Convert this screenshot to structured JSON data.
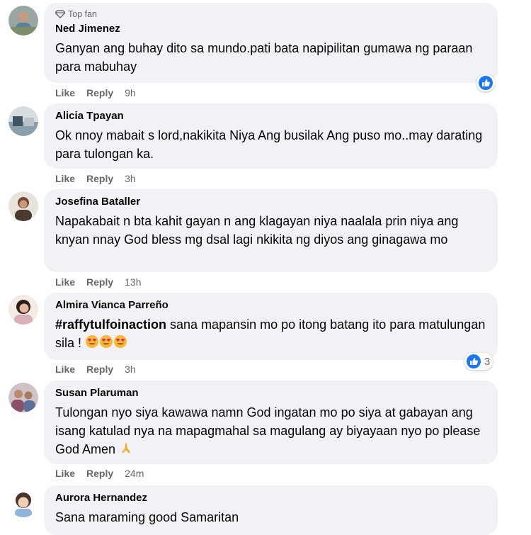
{
  "comments": [
    {
      "badge": "Top fan",
      "name": "Ned Jimenez",
      "text": "Ganyan ang buhay dito sa mundo.pati bata napipilitan gumawa ng paraan para mabuhay",
      "like": "Like",
      "reply": "Reply",
      "time": "9h",
      "reaction_icon": "like-icon"
    },
    {
      "name": "Alicia Tpayan",
      "text": "Ok nnoy mabait s lord,nakikita Niya Ang busilak Ang puso mo..may darating para tulongan ka.",
      "like": "Like",
      "reply": "Reply",
      "time": "3h"
    },
    {
      "name": "Josefina Bataller",
      "text": "Napakabait n bta kahit gayan n ang klagayan niya naalala prin niya ang knyan nnay God bless mg dsal lagi nkikita ng diyos ang ginagawa mo",
      "like": "Like",
      "reply": "Reply",
      "time": "13h"
    },
    {
      "name": "Almira Vianca Parreño",
      "hashtag": "#raffytulfoinaction",
      "text": "sana mapansin mo po itong batang ito para matulungan sila !",
      "emojis": [
        "heart-eyes-emoji",
        "heart-eyes-emoji",
        "heart-eyes-emoji"
      ],
      "like": "Like",
      "reply": "Reply",
      "time": "3h",
      "reaction_icon": "like-icon",
      "reaction_count": "3"
    },
    {
      "name": "Susan Plaruman",
      "text": "Tulongan nyo siya kawawa namn God ingatan mo po siya at gabayan ang isang katulad nya na mapagmahal sa magulang ay biyayaan nyo po please God Amen",
      "emojis": [
        "folded-hands-emoji"
      ],
      "like": "Like",
      "reply": "Reply",
      "time": "24m"
    },
    {
      "name": "Aurora Hernandez",
      "text": "Sana maraming good Samaritan"
    }
  ],
  "colors": {
    "bubble": "#f0f2f5",
    "meta_text": "#65676b",
    "like_blue": "#1877f2"
  }
}
